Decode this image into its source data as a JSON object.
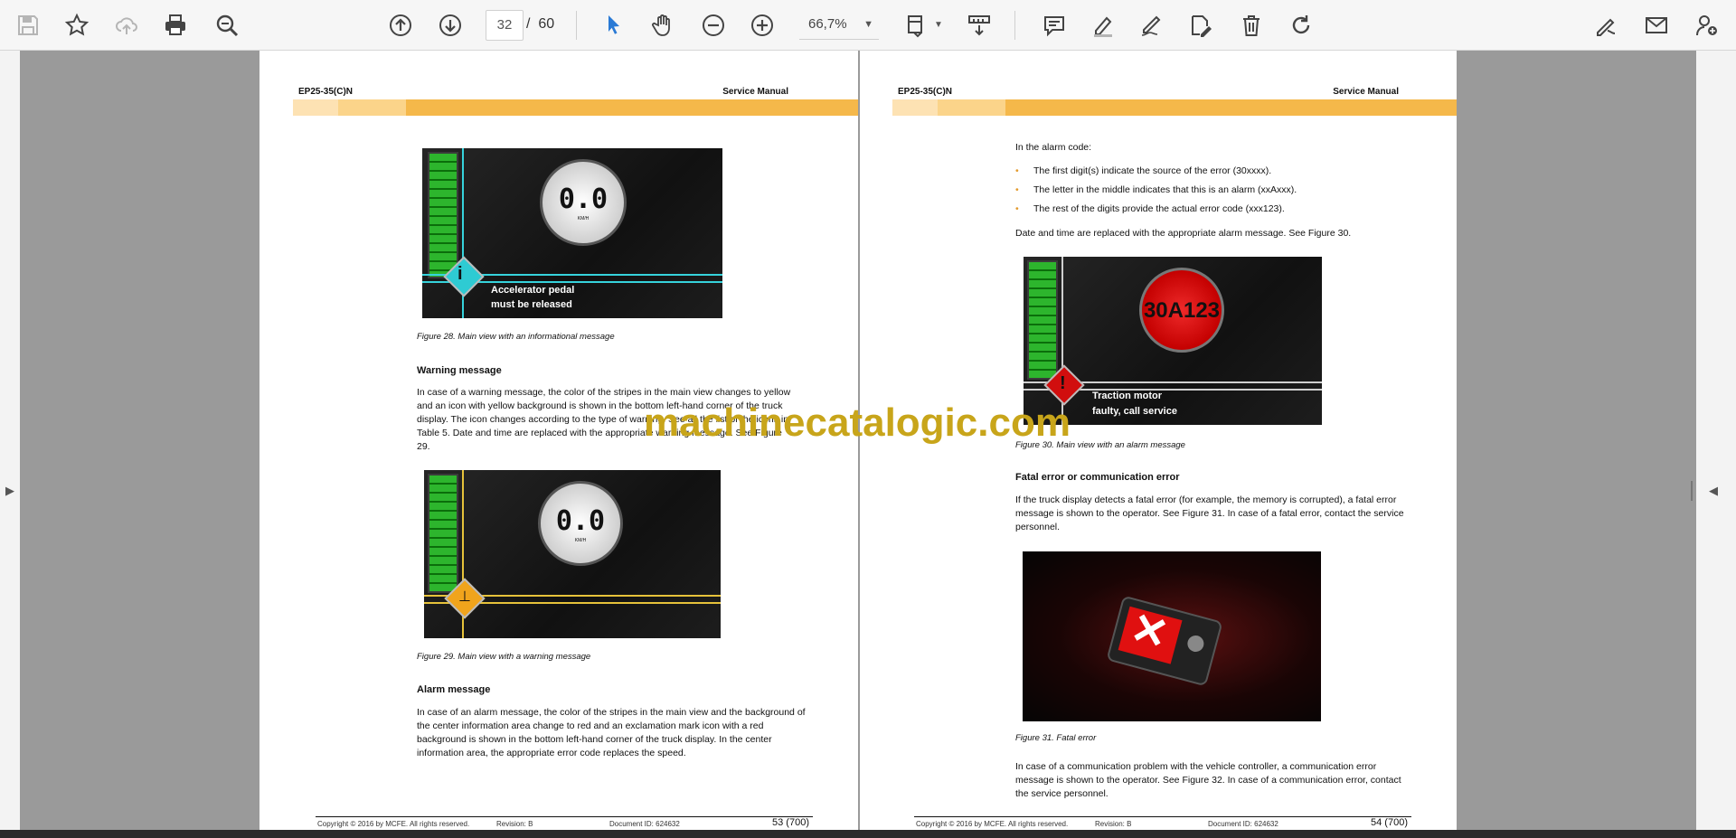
{
  "toolbar": {
    "page_current": "32",
    "page_total": "60",
    "page_sep": "/",
    "zoom": "66,7%"
  },
  "colors": {
    "accent": "#2a7ad5",
    "band": "#f5b84a",
    "band_light": "#fbd48a",
    "band_pale": "#fde2b3"
  },
  "watermark": "machinecatalogic.com",
  "page_left": {
    "header_left": "EP25-35(C)N",
    "header_right": "Service Manual",
    "fig28": {
      "text1": "Accelerator pedal",
      "text2": "must be released",
      "speed": "0.0",
      "unit": "KM/H"
    },
    "caption28": "Figure 28. Main view with an informational message",
    "h_warning": "Warning message",
    "warning_text": "In case of a warning message, the color of the stripes in the main view changes to yellow and an icon with yellow background is shown in the bottom left-hand corner of the truck display. The icon changes according to the type of warning. See all the list of the icons in Table 5. Date and time are replaced with the appropriate warning message. See Figure 29.",
    "fig29": {
      "speed": "0.0",
      "unit": "KM/H"
    },
    "caption29": "Figure 29. Main view with a warning message",
    "h_alarm": "Alarm message",
    "alarm_text": "In case of an alarm message, the color of the stripes in the main view and the background of the center information area change to red and an exclamation mark icon with a red background is shown in the bottom left-hand corner of the truck display. In the center information area, the appropriate error code replaces the speed.",
    "footer": {
      "copyright": "Copyright © 2016 by MCFE. All rights reserved.",
      "revision": "Revision: B",
      "docid": "Document ID: 624632",
      "page": "53 (700)"
    }
  },
  "page_right": {
    "header_left": "EP25-35(C)N",
    "header_right": "Service Manual",
    "intro": "In the alarm code:",
    "bullets": [
      "The first digit(s) indicate the source of the error (30xxxx).",
      "The letter in the middle indicates that this is an alarm (xxAxxx).",
      "The rest of the digits provide the actual error code (xxx123)."
    ],
    "date_text": "Date and time are replaced with the appropriate alarm message. See Figure 30.",
    "fig30": {
      "code": "30A123",
      "text1": "Traction motor",
      "text2": "faulty, call service"
    },
    "caption30": "Figure 30. Main view with an alarm message",
    "h_fatal": "Fatal error or communication error",
    "fatal_text": "If the truck display detects a fatal error (for example, the memory is corrupted), a fatal error message is shown to the operator. See Figure 31. In case of a fatal error, contact the service personnel.",
    "caption31": "Figure 31. Fatal error",
    "comm_text": "In case of a communication problem with the vehicle controller, a communication error message is shown to the operator. See Figure 32. In case of a communication error, contact the service personnel.",
    "footer": {
      "copyright": "Copyright © 2016 by MCFE. All rights reserved.",
      "revision": "Revision: B",
      "docid": "Document ID: 624632",
      "page": "54 (700)"
    }
  }
}
